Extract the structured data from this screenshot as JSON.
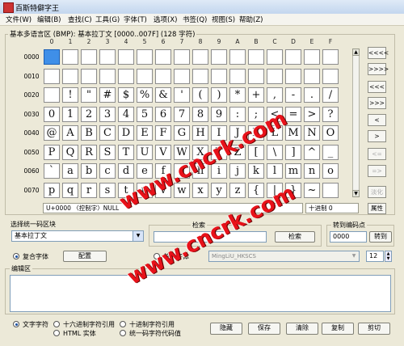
{
  "window": {
    "title": "百斯特僻字王"
  },
  "menu": [
    "文件(W)",
    "编辑(B)",
    "查找(C)",
    "工具(G)",
    "字体(T)",
    "选项(X)",
    "书签(Q)",
    "视图(S)",
    "帮助(Z)"
  ],
  "grid": {
    "label": "基本多语言区 (BMP): 基本拉丁文 [0000..007F] (128 字符)",
    "col_headers": [
      "0",
      "1",
      "2",
      "3",
      "4",
      "5",
      "6",
      "7",
      "8",
      "9",
      "A",
      "B",
      "C",
      "D",
      "E",
      "F"
    ],
    "rows": [
      {
        "label": "0000",
        "cells": [
          "",
          "",
          "",
          "",
          "",
          "",
          "",
          "",
          "",
          "",
          "",
          "",
          "",
          "",
          "",
          ""
        ]
      },
      {
        "label": "0010",
        "cells": [
          "",
          "",
          "",
          "",
          "",
          "",
          "",
          "",
          "",
          "",
          "",
          "",
          "",
          "",
          "",
          ""
        ]
      },
      {
        "label": "0020",
        "cells": [
          "",
          "!",
          "\"",
          "#",
          "$",
          "%",
          "&",
          "'",
          "(",
          ")",
          "*",
          "+",
          ",",
          "-",
          ".",
          "/"
        ]
      },
      {
        "label": "0030",
        "cells": [
          "0",
          "1",
          "2",
          "3",
          "4",
          "5",
          "6",
          "7",
          "8",
          "9",
          ":",
          ";",
          "<",
          "=",
          ">",
          "?"
        ]
      },
      {
        "label": "0040",
        "cells": [
          "@",
          "A",
          "B",
          "C",
          "D",
          "E",
          "F",
          "G",
          "H",
          "I",
          "J",
          "K",
          "L",
          "M",
          "N",
          "O"
        ]
      },
      {
        "label": "0050",
        "cells": [
          "P",
          "Q",
          "R",
          "S",
          "T",
          "U",
          "V",
          "W",
          "X",
          "Y",
          "Z",
          "[",
          "\\",
          "]",
          "^",
          "_"
        ]
      },
      {
        "label": "0060",
        "cells": [
          "`",
          "a",
          "b",
          "c",
          "d",
          "e",
          "f",
          "g",
          "h",
          "i",
          "j",
          "k",
          "l",
          "m",
          "n",
          "o"
        ]
      },
      {
        "label": "0070",
        "cells": [
          "p",
          "q",
          "r",
          "s",
          "t",
          "u",
          "v",
          "w",
          "x",
          "y",
          "z",
          "{",
          "|",
          "}",
          "~",
          ""
        ]
      }
    ],
    "selected": "0000"
  },
  "nav_buttons": [
    "<<<<",
    ">>>>",
    "<<<",
    ">>>",
    "<",
    ">",
    "<=",
    "=>",
    "淡化"
  ],
  "nav_disabled": [
    false,
    false,
    false,
    false,
    false,
    false,
    true,
    true,
    true
  ],
  "status": {
    "char_info": "U+0000 〈控制字〉NULL",
    "decimal": "十进制 0",
    "attr_button": "属性"
  },
  "block_select": {
    "label": "选择统一码区块",
    "value": "基本拉丁文"
  },
  "search": {
    "label": "检索",
    "button": "检索"
  },
  "goto": {
    "label": "转到编码点",
    "value": "0000",
    "button": "转到"
  },
  "font": {
    "composite_label": "复合字体",
    "config_button": "配置",
    "single_label": "单一字体",
    "single_value": "MingLiU_HKSCS",
    "size": "12"
  },
  "edit": {
    "label": "编辑区"
  },
  "output_options": [
    "文字字符",
    "十六进制字符引用",
    "十进制字符引用",
    "HTML 实体",
    "统一码字符代码值"
  ],
  "buttons": {
    "hide": "隐藏",
    "save": "保存",
    "clear": "清除",
    "copy": "复制",
    "cut": "剪切"
  },
  "watermark": {
    "text": "www.cncrk.com",
    "color": "#e8121a"
  }
}
